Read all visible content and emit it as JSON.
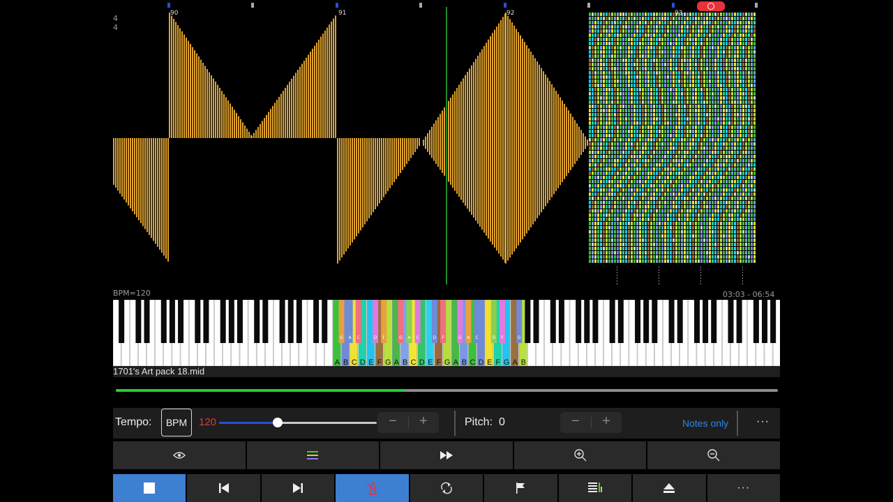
{
  "roll": {
    "time_signature": {
      "num": "4",
      "den": "4"
    },
    "measures": [
      "90",
      "91",
      "92",
      "93"
    ],
    "bpm_label": "BPM=120",
    "time_label": "03:03 - 06:54",
    "note_color": "#e0a32d"
  },
  "keyboard": {
    "note_labels": [
      "A",
      "B",
      "C",
      "D",
      "E",
      "F",
      "G",
      "A",
      "B",
      "C",
      "D",
      "E",
      "F",
      "G",
      "A",
      "B",
      "C",
      "D",
      "E",
      "F",
      "G",
      "A",
      "B"
    ],
    "small_labels": [
      "G",
      "A",
      "C",
      "D",
      "F",
      "G",
      "A",
      "C",
      "D",
      "F",
      "G",
      "A",
      "C",
      "D",
      "F",
      "G",
      "A"
    ],
    "colors": [
      "#3bc23a",
      "#6f8bd6",
      "#f0e030",
      "#1dd4a8",
      "#22c4ef",
      "#9a7040",
      "#b8e040",
      "#4bb64a",
      "#7ea4e6",
      "#f2e634",
      "#35c46a",
      "#2bd0ee",
      "#9a6a3c",
      "#b2df3a",
      "#48b848",
      "#7b98e8"
    ]
  },
  "file": {
    "name": "1701's Art pack 18.mid"
  },
  "playback": {
    "progress_fraction": 0.436
  },
  "tempo": {
    "label": "Tempo:",
    "bpm_button": "BPM",
    "value": "120",
    "slider_fraction": 0.37,
    "minus": "−",
    "plus": "+"
  },
  "pitch": {
    "label": "Pitch:",
    "value": "0",
    "minus": "−",
    "plus": "+"
  },
  "notes_only": "Notes only",
  "more": "···",
  "toolbar1": [
    "eye-icon",
    "color-bars-icon",
    "fast-forward-icon",
    "zoom-in-icon",
    "zoom-out-icon"
  ],
  "toolbar2": [
    "stop-icon",
    "skip-back-icon",
    "skip-forward-icon",
    "metronome-icon",
    "loop-icon",
    "flag-icon",
    "tracks-icon",
    "eject-icon",
    "more-icon"
  ]
}
